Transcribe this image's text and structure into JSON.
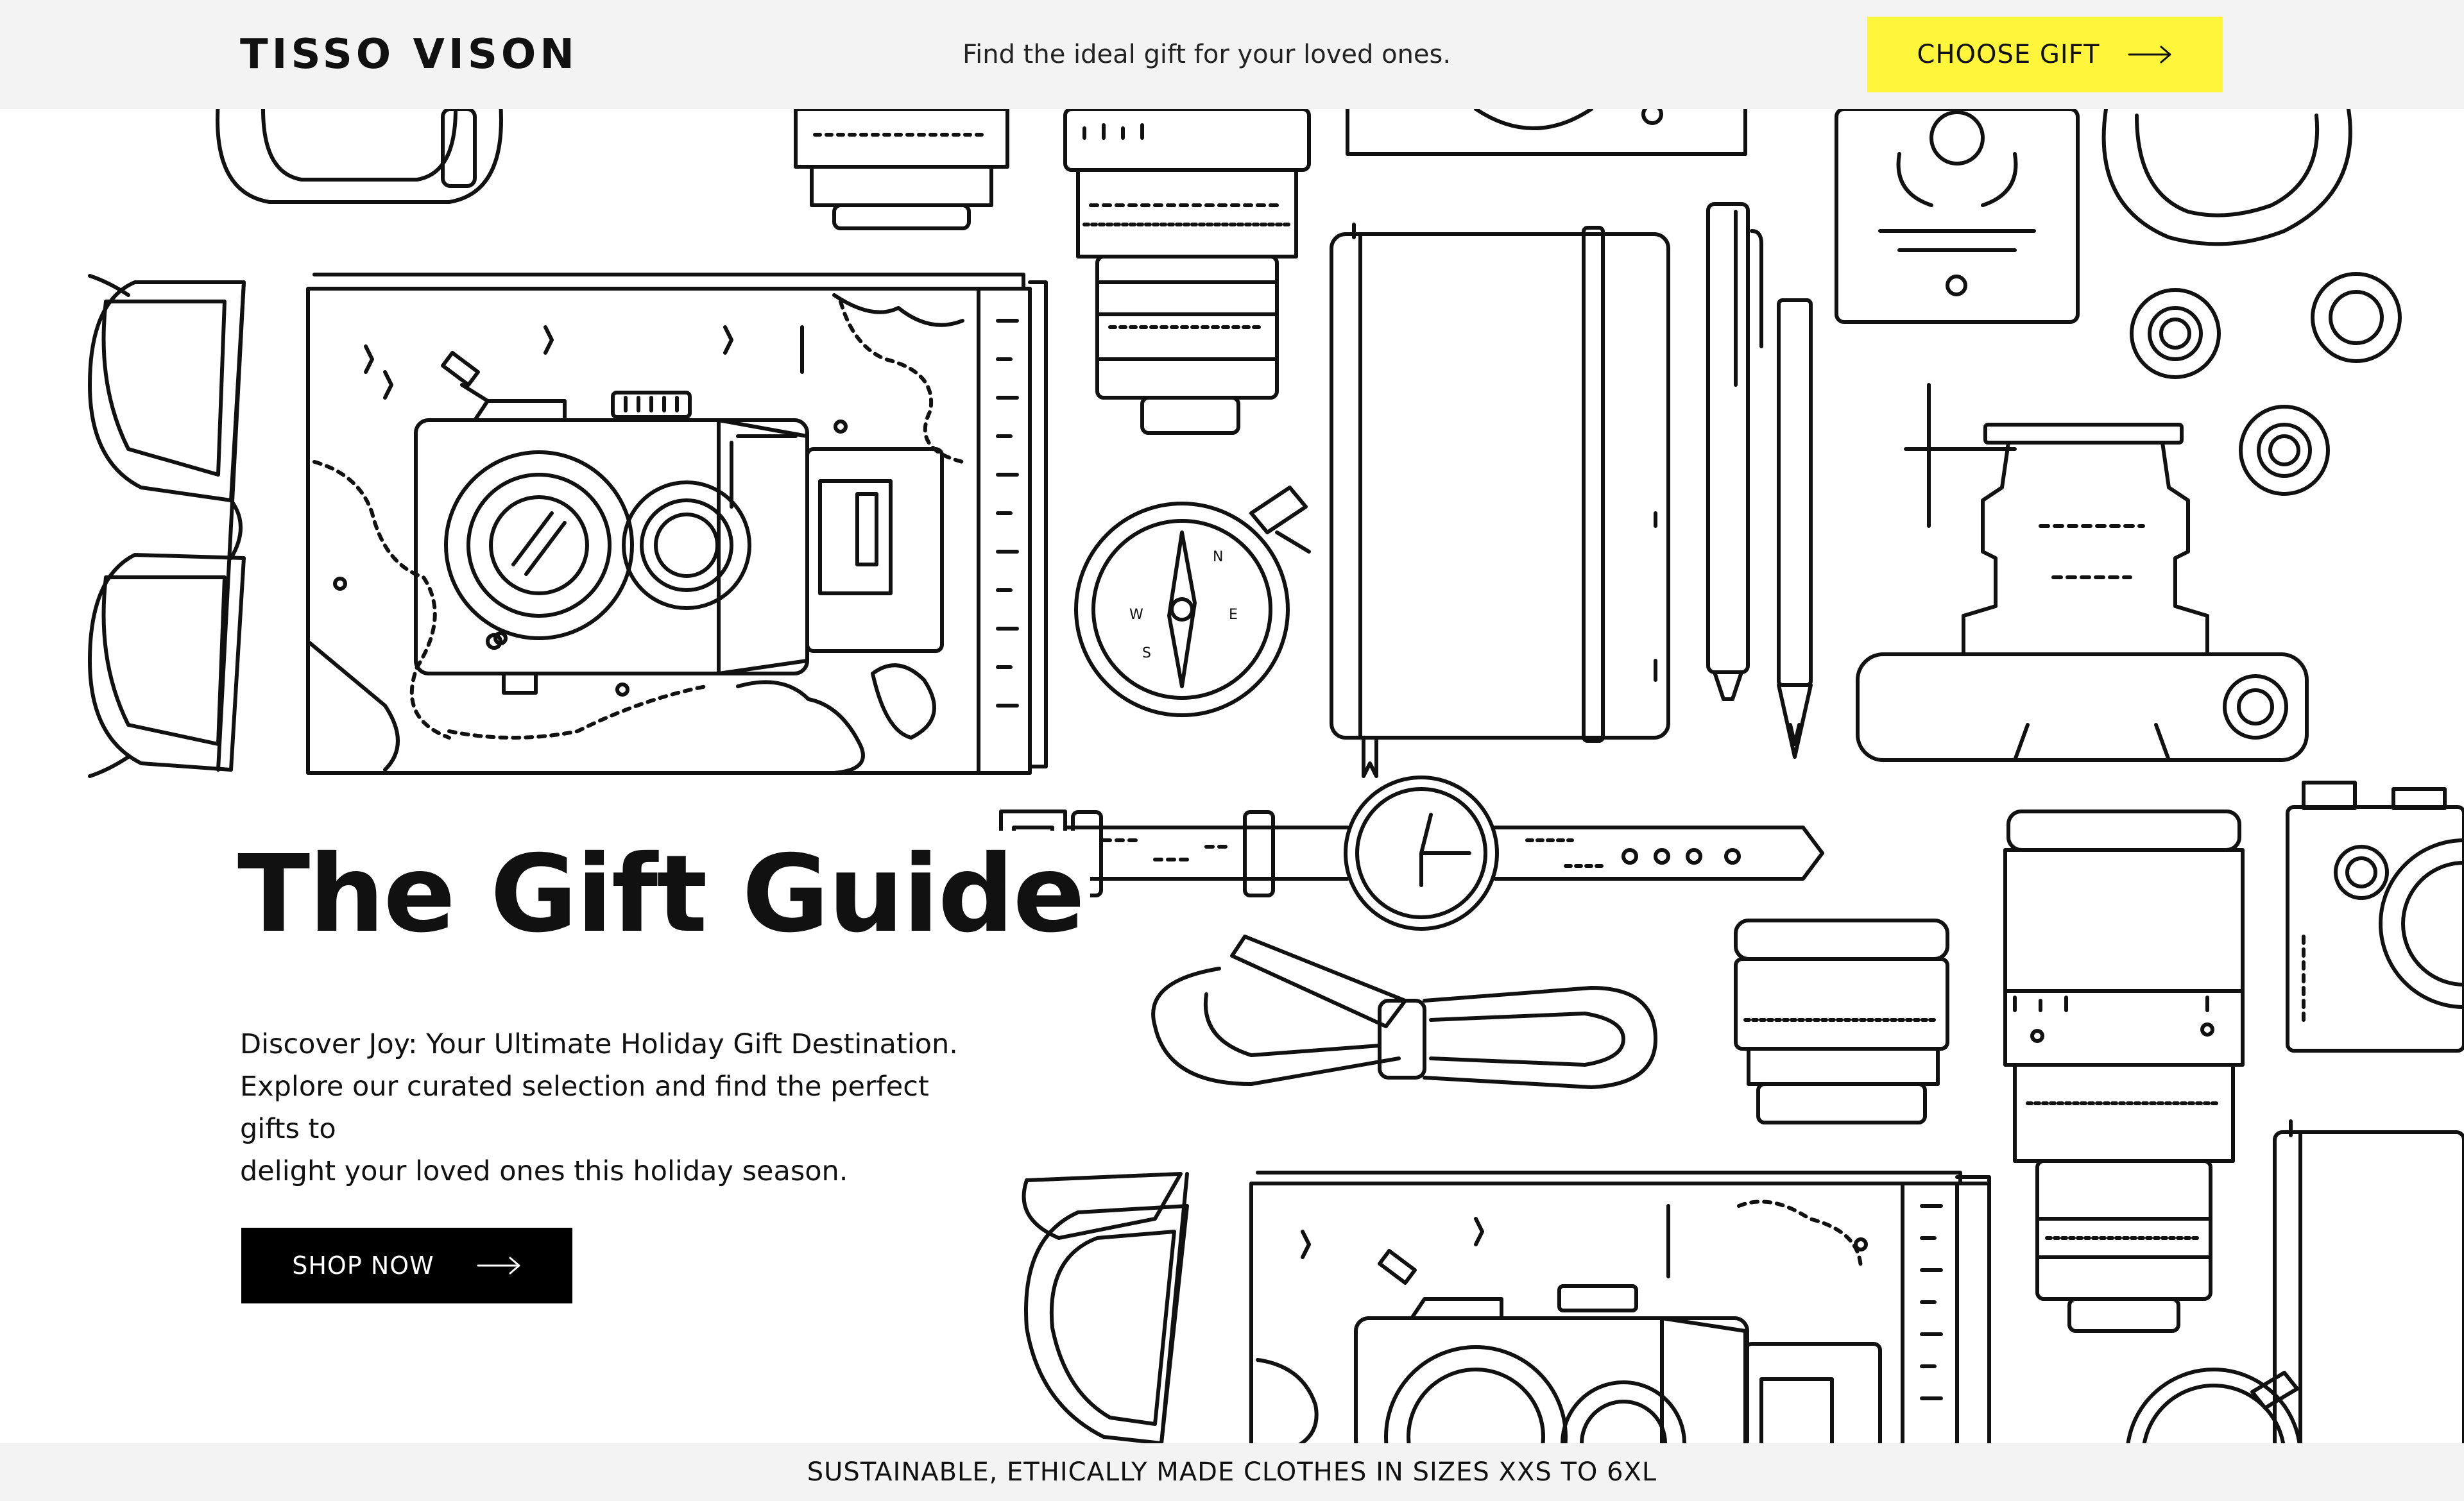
{
  "header": {
    "logo": "TISSO VISON",
    "tagline": "Find the ideal gift for your loved ones.",
    "cta_label": "CHOOSE GIFT",
    "cta_color": "#fff53a",
    "background": "#f3f3f3"
  },
  "hero": {
    "title": "The Gift Guide",
    "description": [
      "Discover Joy: Your Ultimate Holiday Gift Destination.",
      "Explore our curated selection and find the perfect gifts to",
      "delight your loved ones this holiday season."
    ],
    "cta_label": "SHOP NOW"
  },
  "footer": {
    "announcement": "SUSTAINABLE, ETHICALLY MADE CLOTHES IN SIZES XXS TO 6XL"
  },
  "icons": {
    "arrow": "arrow-right-icon"
  }
}
